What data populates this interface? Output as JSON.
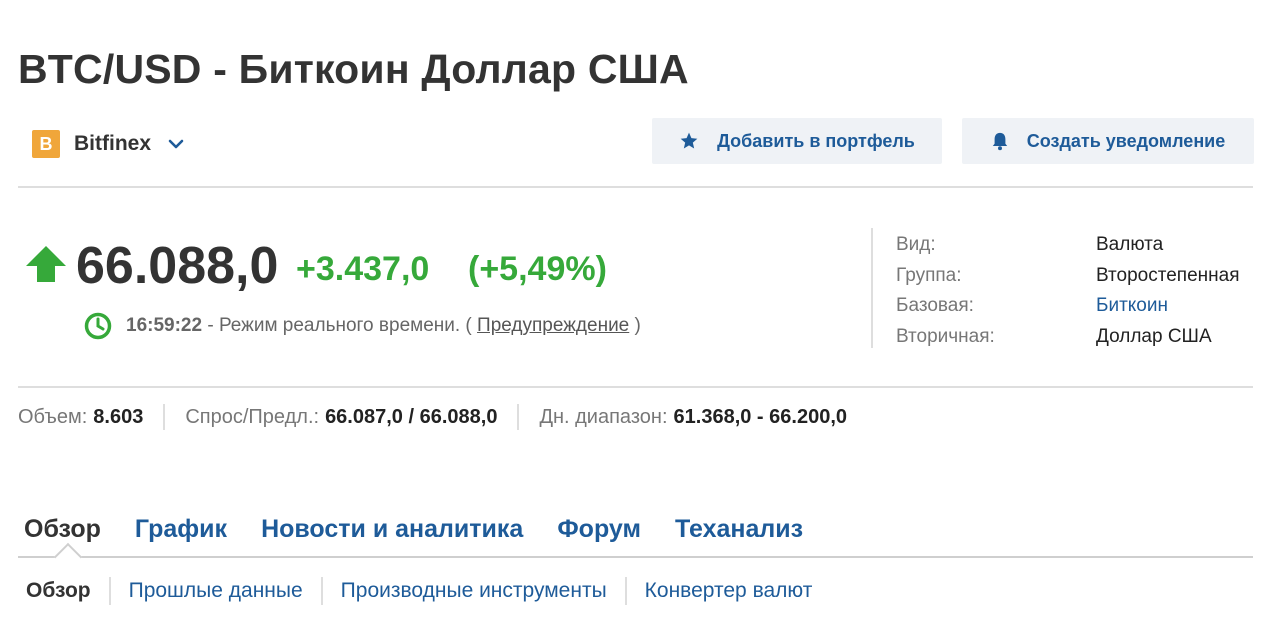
{
  "title": "BTC/USD - Биткоин Доллар США",
  "exchange": {
    "logo_letter": "B",
    "name": "Bitfinex"
  },
  "actions": {
    "portfolio_label": "Добавить в портфель",
    "alert_label": "Создать уведомление"
  },
  "quote": {
    "price": "66.088,0",
    "change": "+3.437,0",
    "change_pct": "(+5,49%)",
    "time": "16:59:22",
    "realtime_text": " - Режим реального времени. ( ",
    "warning_link": "Предупреждение",
    "close_paren": " )"
  },
  "info": [
    {
      "key": "Вид:",
      "value": "Валюта"
    },
    {
      "key": "Группа:",
      "value": "Второстепенная"
    },
    {
      "key": "Базовая:",
      "value": "Биткоин"
    },
    {
      "key": "Вторичная:",
      "value": "Доллар США"
    }
  ],
  "stats": {
    "volume_label": "Объем:",
    "volume": "8.603",
    "bidask_label": "Спрос/Предл.:",
    "bidask": "66.087,0 / 66.088,0",
    "range_label": "Дн. диапазон:",
    "range": "61.368,0 - 66.200,0"
  },
  "tabs": [
    "Обзор",
    "График",
    "Новости и аналитика",
    "Форум",
    "Теханализ"
  ],
  "subtabs": [
    "Обзор",
    "Прошлые данные",
    "Производные инструменты",
    "Конвертер валют"
  ],
  "colors": {
    "accent": "#1e5b99",
    "positive": "#36a93a",
    "exchange_logo": "#f0a63a"
  },
  "icons": [
    "star-icon",
    "bell-icon",
    "arrow-up-icon",
    "clock-icon",
    "chevron-down-icon"
  ]
}
